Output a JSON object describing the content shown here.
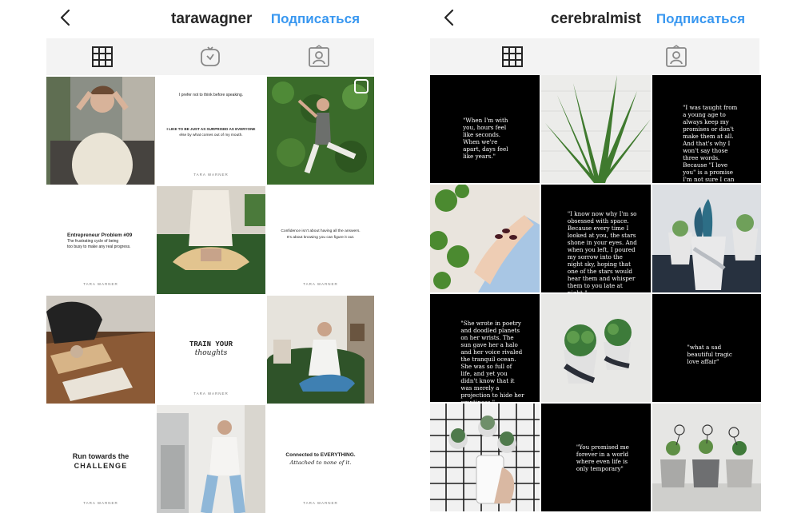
{
  "left": {
    "username": "tarawagner",
    "follow_label": "Подписаться",
    "tiles": {
      "t2": {
        "line1": "I prefer not to think before speaking.",
        "line2": "I LIKE TO BE JUST AS SURPRISED AS EVERYONE",
        "line3": "else by what comes out of my mouth.",
        "sig": "TARA WARNER"
      },
      "t4": {
        "title": "Entrepreneur Problem #09",
        "line1": "The frustrating cycle of being",
        "line2": "too busy to make any real progress.",
        "sig": "TARA WARNER"
      },
      "t6": {
        "line1": "Confidence isn't about having all the answers.",
        "line2": "It's about knowing you can figure it out.",
        "sig": "TARA WARNER"
      },
      "t8": {
        "line1": "TRAIN YOUR",
        "line2": "thoughts",
        "sig": "TARA WARNER"
      },
      "t10": {
        "line1": "Run towards the",
        "line2": "CHALLENGE",
        "sig": "TARA WARNER"
      },
      "t12": {
        "line1": "Connected to EVERYTHING.",
        "line2": "Attached to none of it.",
        "sig": "TARA WARNER"
      }
    }
  },
  "right": {
    "username": "cerebralmist",
    "follow_label": "Подписаться",
    "quotes": {
      "q1": "\"When I'm with you, hours feel like seconds. When we're apart, days feel like years.\"",
      "q3": "\"I was taught from a young age to always keep my promises or don't make them at all. And that's why I won't say those three words. Because \"I love you\" is a promise I'm not sure I can keep.\"",
      "q5": "\"I know now why I'm so obsessed with space. Because every time I looked at you, the stars shone in your eyes. And when you left, I poured my sorrow into the night sky, hoping that one of the stars would hear them and whisper them to you late at night.\"",
      "q7": "\"She wrote in poetry and doodled planets on her wrists. The sun gave her a halo and her voice rivaled the tranquil ocean. She was so full of life, and yet you didn't know that it was merely a projection to hide her emptiness.\"",
      "q9": "\"what a sad beautiful tragic love affair\"",
      "q11": "\"You promised me forever in a world where even life is only temporary\""
    }
  }
}
